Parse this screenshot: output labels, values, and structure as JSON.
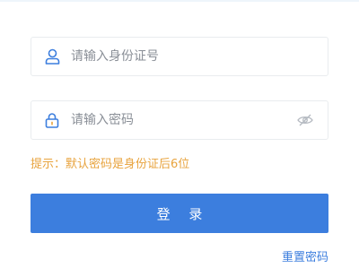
{
  "form": {
    "id_field": {
      "value": "",
      "placeholder": "请输入身份证号",
      "icon": "user-icon"
    },
    "password_field": {
      "value": "",
      "placeholder": "请输入密码",
      "icon": "lock-icon",
      "toggle_icon": "eye-hidden-icon"
    },
    "hint": "提示：默认密码是身份证后6位",
    "login_label": "登 录",
    "reset_label": "重置密码"
  },
  "colors": {
    "primary": "#3c7ede",
    "hint": "#e8a33d",
    "border": "#e9ecef",
    "placeholder": "#8a8f97"
  }
}
